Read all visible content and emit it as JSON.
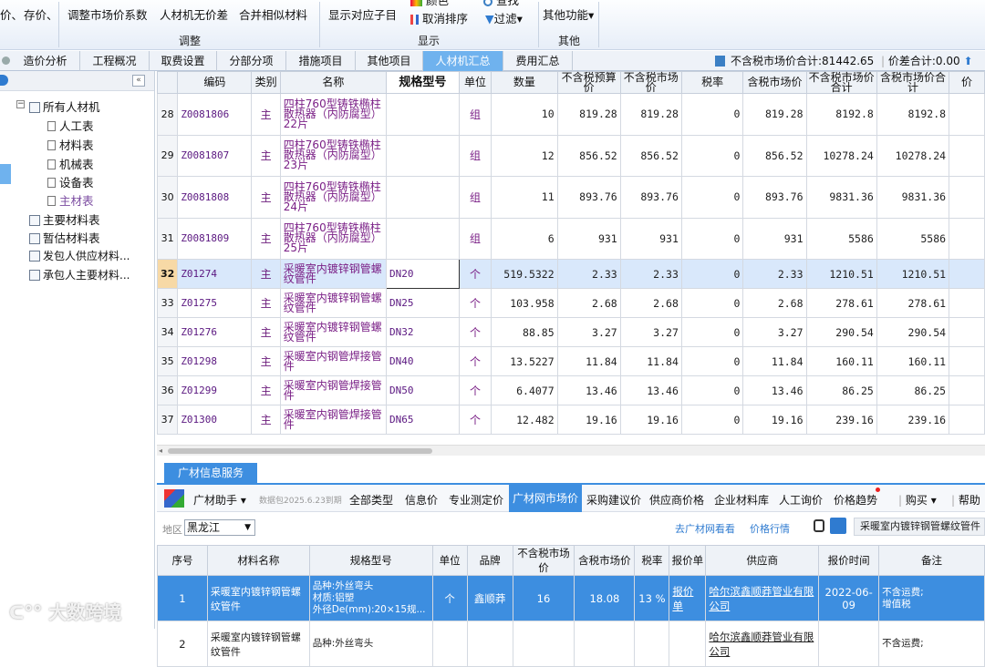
{
  "ribbon": {
    "price_fn": "价、",
    "save_price": "存价、",
    "adjust_coefficient": "调整市场价系数",
    "no_price_item": "人材机无价差",
    "merge_similar": "合并相似材料",
    "show_sub_items": "显示对应子目",
    "color": "颜色",
    "find": "查找",
    "cancel_sort": "取消排序",
    "filter": "过滤",
    "other_functions": "其他功能",
    "group_adjust": "调整",
    "group_show": "显示",
    "group_other": "其他"
  },
  "tabs": [
    {
      "label": "造价分析"
    },
    {
      "label": "工程概况"
    },
    {
      "label": "取费设置"
    },
    {
      "label": "分部分项"
    },
    {
      "label": "措施项目"
    },
    {
      "label": "其他项目"
    },
    {
      "label": "人材机汇总"
    },
    {
      "label": "费用汇总"
    }
  ],
  "summary": {
    "market_total": "不含税市场价合计:81442.65",
    "diff_total": "价差合计:0.00"
  },
  "tree": {
    "collapse": "«",
    "root": "所有人材机",
    "children": [
      "人工表",
      "材料表",
      "机械表",
      "设备表",
      "主材表"
    ],
    "others": [
      "主要材料表",
      "暂估材料表",
      "发包人供应材料...",
      "承包人主要材料..."
    ]
  },
  "grid": {
    "headers": [
      "",
      "编码",
      "类别",
      "名称",
      "规格型号",
      "单位",
      "数量",
      "不含税预算价",
      "不含税市场价",
      "税率",
      "含税市场价",
      "不含税市场价合计",
      "含税市场价合计",
      "价"
    ],
    "rows": [
      {
        "no": "28",
        "code": "Z0081806",
        "type": "主",
        "name": "四柱760型铸铁椭柱散热器（内防腐型）22片",
        "spec": "",
        "unit": "组",
        "qty": "10",
        "budget": "819.28",
        "market": "819.28",
        "tax": "0",
        "taxed": "819.28",
        "total": "8192.8",
        "taxed_total": "8192.8"
      },
      {
        "no": "29",
        "code": "Z0081807",
        "type": "主",
        "name": "四柱760型铸铁椭柱散热器（内防腐型）23片",
        "spec": "",
        "unit": "组",
        "qty": "12",
        "budget": "856.52",
        "market": "856.52",
        "tax": "0",
        "taxed": "856.52",
        "total": "10278.24",
        "taxed_total": "10278.24"
      },
      {
        "no": "30",
        "code": "Z0081808",
        "type": "主",
        "name": "四柱760型铸铁椭柱散热器（内防腐型）24片",
        "spec": "",
        "unit": "组",
        "qty": "11",
        "budget": "893.76",
        "market": "893.76",
        "tax": "0",
        "taxed": "893.76",
        "total": "9831.36",
        "taxed_total": "9831.36"
      },
      {
        "no": "31",
        "code": "Z0081809",
        "type": "主",
        "name": "四柱760型铸铁椭柱散热器（内防腐型）25片",
        "spec": "",
        "unit": "组",
        "qty": "6",
        "budget": "931",
        "market": "931",
        "tax": "0",
        "taxed": "931",
        "total": "5586",
        "taxed_total": "5586"
      },
      {
        "no": "32",
        "code": "Z01274",
        "type": "主",
        "name": "采暖室内镀锌钢管螺纹管件",
        "spec": "DN20",
        "unit": "个",
        "qty": "519.5322",
        "budget": "2.33",
        "market": "2.33",
        "tax": "0",
        "taxed": "2.33",
        "total": "1210.51",
        "taxed_total": "1210.51"
      },
      {
        "no": "33",
        "code": "Z01275",
        "type": "主",
        "name": "采暖室内镀锌钢管螺纹管件",
        "spec": "DN25",
        "unit": "个",
        "qty": "103.958",
        "budget": "2.68",
        "market": "2.68",
        "tax": "0",
        "taxed": "2.68",
        "total": "278.61",
        "taxed_total": "278.61"
      },
      {
        "no": "34",
        "code": "Z01276",
        "type": "主",
        "name": "采暖室内镀锌钢管螺纹管件",
        "spec": "DN32",
        "unit": "个",
        "qty": "88.85",
        "budget": "3.27",
        "market": "3.27",
        "tax": "0",
        "taxed": "3.27",
        "total": "290.54",
        "taxed_total": "290.54"
      },
      {
        "no": "35",
        "code": "Z01298",
        "type": "主",
        "name": "采暖室内钢管焊接管件",
        "spec": "DN40",
        "unit": "个",
        "qty": "13.5227",
        "budget": "11.84",
        "market": "11.84",
        "tax": "0",
        "taxed": "11.84",
        "total": "160.11",
        "taxed_total": "160.11"
      },
      {
        "no": "36",
        "code": "Z01299",
        "type": "主",
        "name": "采暖室内钢管焊接管件",
        "spec": "DN50",
        "unit": "个",
        "qty": "6.4077",
        "budget": "13.46",
        "market": "13.46",
        "tax": "0",
        "taxed": "13.46",
        "total": "86.25",
        "taxed_total": "86.25"
      },
      {
        "no": "37",
        "code": "Z01300",
        "type": "主",
        "name": "采暖室内钢管焊接管件",
        "spec": "DN65",
        "unit": "个",
        "qty": "12.482",
        "budget": "19.16",
        "market": "19.16",
        "tax": "0",
        "taxed": "19.16",
        "total": "239.16",
        "taxed_total": "239.16"
      }
    ]
  },
  "bottom": {
    "panel_tab": "广材信息服务",
    "assistant": "广材助手",
    "package_note": "数据包2025.6.23到期",
    "tools": [
      "全部类型",
      "信息价",
      "专业测定价",
      "广材网市场价",
      "采购建议价",
      "供应商价格",
      "企业材料库",
      "人工询价",
      "价格趋势",
      "购买",
      "帮助"
    ],
    "region_label": "地区",
    "region_value": "黑龙江",
    "goto_site": "去广材网看看",
    "price_quote": "价格行情",
    "search_value": "采暖室内镀锌钢管螺纹管件",
    "headers": [
      "序号",
      "材料名称",
      "规格型号",
      "单位",
      "品牌",
      "不含税市场价",
      "含税市场价",
      "税率",
      "报价单",
      "供应商",
      "报价时间",
      "备注"
    ],
    "rows": [
      {
        "no": "1",
        "name": "采暖室内镀锌钢管螺纹管件",
        "spec": "品种:外丝弯头\n材质:铝塑\n外径De(mm):20×15规...",
        "unit": "个",
        "brand": "鑫顺莽",
        "price": "16",
        "taxed": "18.08",
        "tax": "13 %",
        "quote": "报价单",
        "supplier": "哈尔滨鑫顺莽管业有限公司",
        "date": "2022-06-09",
        "note": "不含运费;\n增值税"
      },
      {
        "no": "2",
        "name": "采暖室内镀锌钢管螺纹管件",
        "spec": "品种:外丝弯头",
        "unit": "",
        "brand": "",
        "price": "",
        "taxed": "",
        "tax": "",
        "quote": "",
        "supplier": "哈尔滨鑫顺莽管业有限公司",
        "date": "",
        "note": "不含运费;"
      }
    ]
  },
  "watermark": "大数跨境",
  "colors": {
    "accent": "#3d8ee0",
    "active_tab": "#6fb2ee",
    "selected_row": "#d9e8fb",
    "text_purple": "#7a1f86"
  }
}
